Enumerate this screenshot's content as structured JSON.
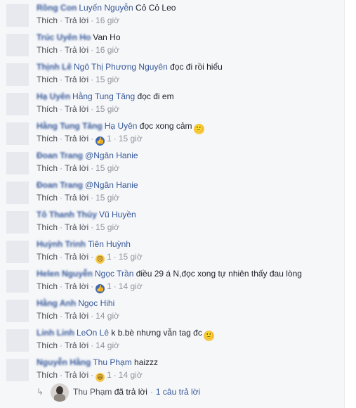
{
  "actions": {
    "like": "Thích",
    "reply": "Trả lời"
  },
  "comments": [
    {
      "author": "Rồng Con",
      "mentions": "Luyến Nguyễn",
      "text": " Cỏ Cỏ Leo",
      "time": "16 giờ"
    },
    {
      "author": "Trúc Uyên Ho",
      "mentions": "",
      "text": "Van Ho",
      "time": "16 giờ"
    },
    {
      "author": "Thịnh Lê",
      "mentions": "Ngô Thị Phương Nguyên",
      "text": " đọc đi rồi hiểu",
      "time": "15 giờ"
    },
    {
      "author": "Hạ Uyên",
      "mentions": "Hằng Tung Tăng",
      "text": " đọc đi em",
      "time": "15 giờ"
    },
    {
      "author": "Hằng Tung Tăng",
      "mentions": "Hạ Uyên",
      "text": " đọc xong cảm",
      "emoji": "🙂",
      "reaction": "like",
      "reaction_glyph": "👍",
      "reaction_count": "1",
      "time": "15 giờ"
    },
    {
      "author": "Đoan Trang",
      "mentions": "@Ngân Hanie",
      "text": "",
      "time": "15 giờ"
    },
    {
      "author": "Đoan Trang",
      "mentions": "@Ngân Hanie",
      "text": "",
      "time": "15 giờ"
    },
    {
      "author": "Tô Thanh Thủy",
      "mentions": "Vũ Huyền",
      "text": "",
      "time": "15 giờ"
    },
    {
      "author": "Huỳnh Trinh",
      "mentions": "Tiên Huỳnh",
      "text": "",
      "reaction": "sad",
      "reaction_glyph": "😢",
      "reaction_count": "1",
      "time": "15 giờ"
    },
    {
      "author": "Helen Nguyễn",
      "mentions": "Ngọc Trần",
      "text": " điều 29 á N,đọc xong tự nhiên thấy đau lòng",
      "reaction": "like",
      "reaction_glyph": "👍",
      "reaction_count": "1",
      "time": "14 giờ"
    },
    {
      "author": "Hằng Anh",
      "mentions": "Ngọc Hihi",
      "text": "",
      "time": "14 giờ"
    },
    {
      "author": "Linh Linh",
      "mentions": "LeOn Lê",
      "text": " k b.bè nhưng vẫn tag đc",
      "emoji": "🙂",
      "time": "14 giờ"
    },
    {
      "author": "Nguyễn Hằng",
      "mentions": "Thu Phạm",
      "text": " haizzz",
      "reaction": "haha",
      "reaction_glyph": "😆",
      "reaction_count": "1",
      "time": "14 giờ"
    }
  ],
  "reply_summary": {
    "icon": "reply-arrow-icon",
    "name": "Thu Phạm",
    "verb": " đã trả lời",
    "separator": "·",
    "link": "1 câu trả lời"
  }
}
